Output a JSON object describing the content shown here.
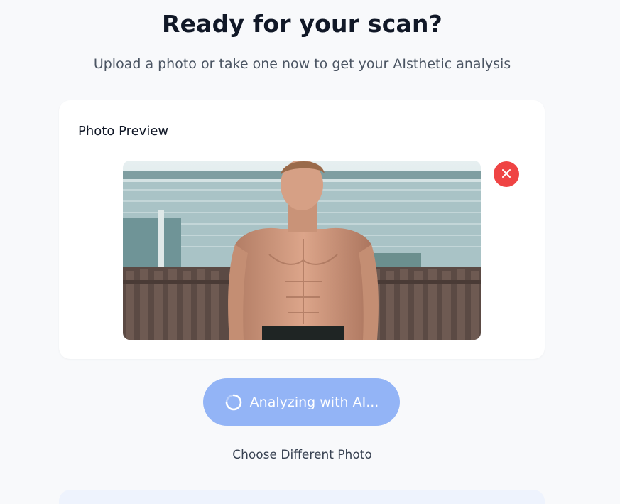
{
  "header": {
    "title": "Ready for your scan?",
    "subtitle": "Upload a photo or take one now to get your AIsthetic analysis"
  },
  "preview": {
    "label": "Photo Preview",
    "remove_icon": "close-icon"
  },
  "actions": {
    "analyze_label": "Analyzing with AI...",
    "choose_label": "Choose Different Photo"
  },
  "colors": {
    "background": "#f8f9fb",
    "remove_button": "#ef4444",
    "analyze_button": "#93b4f6",
    "title": "#111827"
  }
}
